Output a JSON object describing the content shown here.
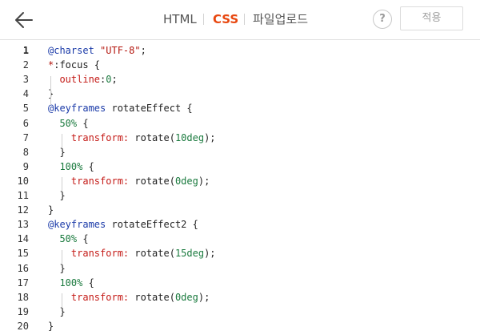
{
  "header": {
    "tabs": [
      {
        "label": "HTML",
        "active": false
      },
      {
        "label": "CSS",
        "active": true
      },
      {
        "label": "파일업로드",
        "active": false
      }
    ],
    "help_label": "?",
    "apply_label": "적용"
  },
  "colors": {
    "active_tab": "#e8470f",
    "keyword": "#1a3aa8",
    "string": "#b4170f",
    "property": "#c41a16",
    "number": "#1a7a3e"
  },
  "editor": {
    "current_line": 1,
    "lines": [
      {
        "n": "1",
        "tokens": [
          {
            "t": "@charset",
            "c": "kw"
          },
          {
            "t": " ",
            "c": "plain"
          },
          {
            "t": "\"UTF-8\"",
            "c": "str"
          },
          {
            "t": ";",
            "c": "plain"
          }
        ]
      },
      {
        "n": "2",
        "tokens": [
          {
            "t": "*",
            "c": "sel"
          },
          {
            "t": ":focus {",
            "c": "plain"
          }
        ]
      },
      {
        "n": "3",
        "tokens": [
          {
            "t": "  ",
            "c": "plain"
          },
          {
            "t": "outline",
            "c": "prop"
          },
          {
            "t": ":",
            "c": "plain"
          },
          {
            "t": "0",
            "c": "num"
          },
          {
            "t": ";",
            "c": "plain"
          }
        ]
      },
      {
        "n": "4",
        "tokens": [
          {
            "t": "}",
            "c": "plain"
          }
        ]
      },
      {
        "n": "5",
        "tokens": [
          {
            "t": "@keyframes",
            "c": "kw"
          },
          {
            "t": " rotateEffect {",
            "c": "plain"
          }
        ]
      },
      {
        "n": "6",
        "tokens": [
          {
            "t": "  ",
            "c": "plain"
          },
          {
            "t": "50%",
            "c": "num"
          },
          {
            "t": " {",
            "c": "plain"
          }
        ]
      },
      {
        "n": "7",
        "tokens": [
          {
            "t": "    ",
            "c": "plain"
          },
          {
            "t": "transform:",
            "c": "prop"
          },
          {
            "t": " rotate(",
            "c": "plain"
          },
          {
            "t": "10deg",
            "c": "num"
          },
          {
            "t": ");",
            "c": "plain"
          }
        ]
      },
      {
        "n": "8",
        "tokens": [
          {
            "t": "  }",
            "c": "plain"
          }
        ]
      },
      {
        "n": "9",
        "tokens": [
          {
            "t": "  ",
            "c": "plain"
          },
          {
            "t": "100%",
            "c": "num"
          },
          {
            "t": " {",
            "c": "plain"
          }
        ]
      },
      {
        "n": "10",
        "tokens": [
          {
            "t": "    ",
            "c": "plain"
          },
          {
            "t": "transform:",
            "c": "prop"
          },
          {
            "t": " rotate(",
            "c": "plain"
          },
          {
            "t": "0deg",
            "c": "num"
          },
          {
            "t": ");",
            "c": "plain"
          }
        ]
      },
      {
        "n": "11",
        "tokens": [
          {
            "t": "  }",
            "c": "plain"
          }
        ]
      },
      {
        "n": "12",
        "tokens": [
          {
            "t": "}",
            "c": "plain"
          }
        ]
      },
      {
        "n": "13",
        "tokens": [
          {
            "t": "@keyframes",
            "c": "kw"
          },
          {
            "t": " rotateEffect2 {",
            "c": "plain"
          }
        ]
      },
      {
        "n": "14",
        "tokens": [
          {
            "t": "  ",
            "c": "plain"
          },
          {
            "t": "50%",
            "c": "num"
          },
          {
            "t": " {",
            "c": "plain"
          }
        ]
      },
      {
        "n": "15",
        "tokens": [
          {
            "t": "    ",
            "c": "plain"
          },
          {
            "t": "transform:",
            "c": "prop"
          },
          {
            "t": " rotate(",
            "c": "plain"
          },
          {
            "t": "15deg",
            "c": "num"
          },
          {
            "t": ");",
            "c": "plain"
          }
        ]
      },
      {
        "n": "16",
        "tokens": [
          {
            "t": "  }",
            "c": "plain"
          }
        ]
      },
      {
        "n": "17",
        "tokens": [
          {
            "t": "  ",
            "c": "plain"
          },
          {
            "t": "100%",
            "c": "num"
          },
          {
            "t": " {",
            "c": "plain"
          }
        ]
      },
      {
        "n": "18",
        "tokens": [
          {
            "t": "    ",
            "c": "plain"
          },
          {
            "t": "transform:",
            "c": "prop"
          },
          {
            "t": " rotate(",
            "c": "plain"
          },
          {
            "t": "0deg",
            "c": "num"
          },
          {
            "t": ");",
            "c": "plain"
          }
        ]
      },
      {
        "n": "19",
        "tokens": [
          {
            "t": "  }",
            "c": "plain"
          }
        ]
      },
      {
        "n": "20",
        "tokens": [
          {
            "t": "}",
            "c": "plain"
          }
        ]
      }
    ]
  }
}
